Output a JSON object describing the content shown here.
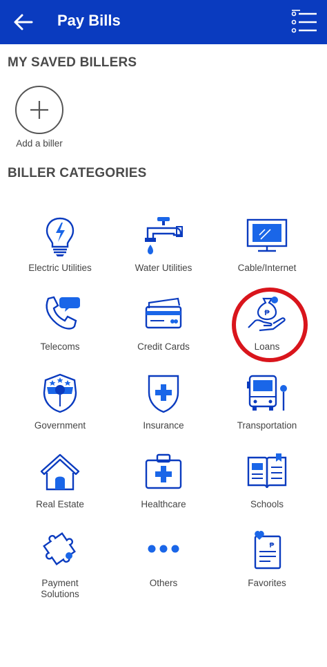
{
  "header": {
    "title": "Pay Bills",
    "back_icon": "arrow-left-icon",
    "menu_icon": "list-menu-icon",
    "bg_color": "#0a3bbf"
  },
  "saved": {
    "title": "MY SAVED BILLERS",
    "add_label": "Add a biller"
  },
  "categories_title": "BILLER CATEGORIES",
  "categories": [
    {
      "label": "Electric Utilities",
      "icon": "lightbulb-icon"
    },
    {
      "label": "Water Utilities",
      "icon": "faucet-icon"
    },
    {
      "label": "Cable/Internet",
      "icon": "monitor-icon"
    },
    {
      "label": "Telecoms",
      "icon": "phone-icon"
    },
    {
      "label": "Credit Cards",
      "icon": "credit-card-icon"
    },
    {
      "label": "Loans",
      "icon": "money-bag-hand-icon"
    },
    {
      "label": "Government",
      "icon": "government-shield-icon"
    },
    {
      "label": "Insurance",
      "icon": "insurance-shield-icon"
    },
    {
      "label": "Transportation",
      "icon": "bus-icon"
    },
    {
      "label": "Real Estate",
      "icon": "house-icon"
    },
    {
      "label": "Healthcare",
      "icon": "first-aid-kit-icon"
    },
    {
      "label": "Schools",
      "icon": "book-icon"
    },
    {
      "label": "Payment Solutions",
      "icon": "puzzle-icon"
    },
    {
      "label": "Others",
      "icon": "dots-icon"
    },
    {
      "label": "Favorites",
      "icon": "favorite-bill-icon"
    }
  ],
  "colors": {
    "accent": "#1a66e8",
    "highlight_ring": "#d9151c"
  }
}
